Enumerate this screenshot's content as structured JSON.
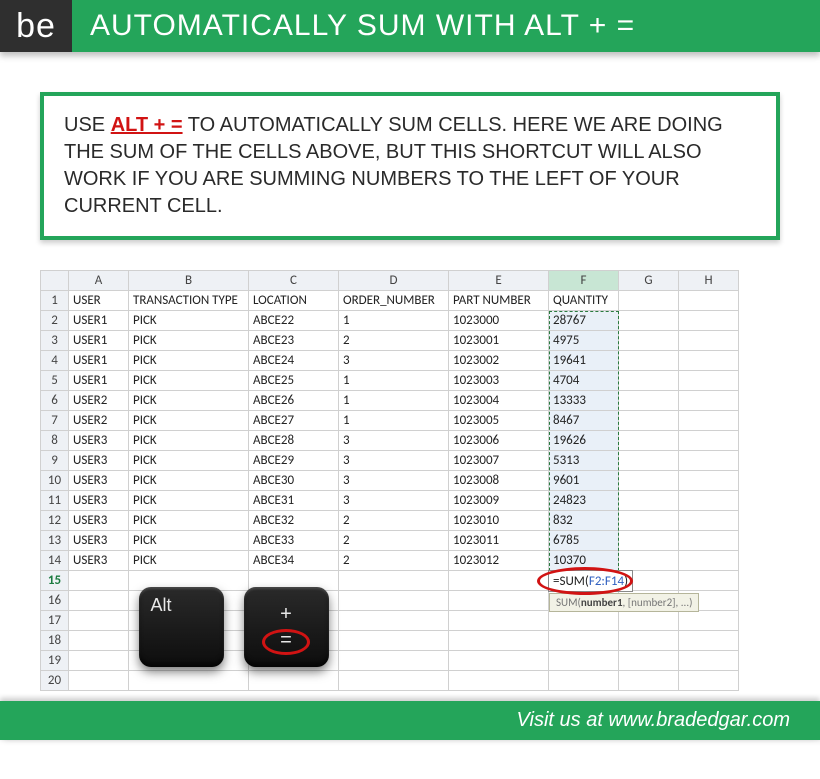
{
  "banner": {
    "logo": "be",
    "title": "AUTOMATICALLY SUM WITH ALT + ="
  },
  "tip": {
    "lead": "USE ",
    "kw": "ALT + =",
    "rest": " TO AUTOMATICALLY SUM CELLS.  HERE WE ARE DOING THE SUM OF THE CELLS ABOVE, BUT THIS SHORTCUT WILL ALSO WORK IF YOU ARE SUMMING NUMBERS TO THE LEFT OF YOUR CURRENT CELL."
  },
  "sheet": {
    "cols": [
      "A",
      "B",
      "C",
      "D",
      "E",
      "F",
      "G",
      "H"
    ],
    "headers": [
      "USER",
      "TRANSACTION TYPE",
      "LOCATION",
      "ORDER_NUMBER",
      "PART NUMBER",
      "QUANTITY"
    ],
    "rows": [
      {
        "n": 1
      },
      {
        "n": 2,
        "c": [
          "USER1",
          "PICK",
          "ABCE22",
          "1",
          "1023000",
          "28767"
        ]
      },
      {
        "n": 3,
        "c": [
          "USER1",
          "PICK",
          "ABCE23",
          "2",
          "1023001",
          "4975"
        ]
      },
      {
        "n": 4,
        "c": [
          "USER1",
          "PICK",
          "ABCE24",
          "3",
          "1023002",
          "19641"
        ]
      },
      {
        "n": 5,
        "c": [
          "USER1",
          "PICK",
          "ABCE25",
          "1",
          "1023003",
          "4704"
        ]
      },
      {
        "n": 6,
        "c": [
          "USER2",
          "PICK",
          "ABCE26",
          "1",
          "1023004",
          "13333"
        ]
      },
      {
        "n": 7,
        "c": [
          "USER2",
          "PICK",
          "ABCE27",
          "1",
          "1023005",
          "8467"
        ]
      },
      {
        "n": 8,
        "c": [
          "USER3",
          "PICK",
          "ABCE28",
          "3",
          "1023006",
          "19626"
        ]
      },
      {
        "n": 9,
        "c": [
          "USER3",
          "PICK",
          "ABCE29",
          "3",
          "1023007",
          "5313"
        ]
      },
      {
        "n": 10,
        "c": [
          "USER3",
          "PICK",
          "ABCE30",
          "3",
          "1023008",
          "9601"
        ]
      },
      {
        "n": 11,
        "c": [
          "USER3",
          "PICK",
          "ABCE31",
          "3",
          "1023009",
          "24823"
        ]
      },
      {
        "n": 12,
        "c": [
          "USER3",
          "PICK",
          "ABCE32",
          "2",
          "1023010",
          "832"
        ]
      },
      {
        "n": 13,
        "c": [
          "USER3",
          "PICK",
          "ABCE33",
          "2",
          "1023011",
          "6785"
        ]
      },
      {
        "n": 14,
        "c": [
          "USER3",
          "PICK",
          "ABCE34",
          "2",
          "1023012",
          "10370"
        ]
      },
      {
        "n": 15
      },
      {
        "n": 16
      },
      {
        "n": 17
      },
      {
        "n": 18
      },
      {
        "n": 19
      },
      {
        "n": 20
      }
    ],
    "active_row": 15,
    "active_col": "F",
    "formula_prefix": "=SUM(",
    "formula_range": "F2:F14",
    "formula_suffix": ")",
    "tooltip_bold": "number1",
    "tooltip_rest": ", [number2], ...)",
    "tooltip_lead": "SUM("
  },
  "keys": {
    "alt": "Alt",
    "plus": "+",
    "eq": "="
  },
  "footer": "Visit us at www.bradedgar.com"
}
